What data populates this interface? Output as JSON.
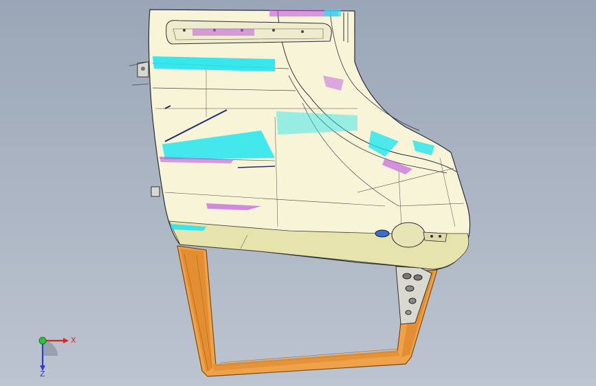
{
  "viewport": {
    "background_top": "#9aa6b7",
    "background_bottom": "#bcc4d0"
  },
  "model": {
    "panel_color": "#f7f4d8",
    "panel_shade_color": "#e9e6b5",
    "frame_color": "#f0a24a",
    "accent_cyan": "#22e5ef",
    "accent_magenta": "#c15ae0",
    "edge_color": "#2b2b3a"
  },
  "triad": {
    "x_label": "X",
    "z_label": "Z",
    "x_color": "#e0241f",
    "y_color": "#2fbf3a",
    "z_color": "#2a3fd1",
    "icon": "coordinate-triad-icon"
  }
}
